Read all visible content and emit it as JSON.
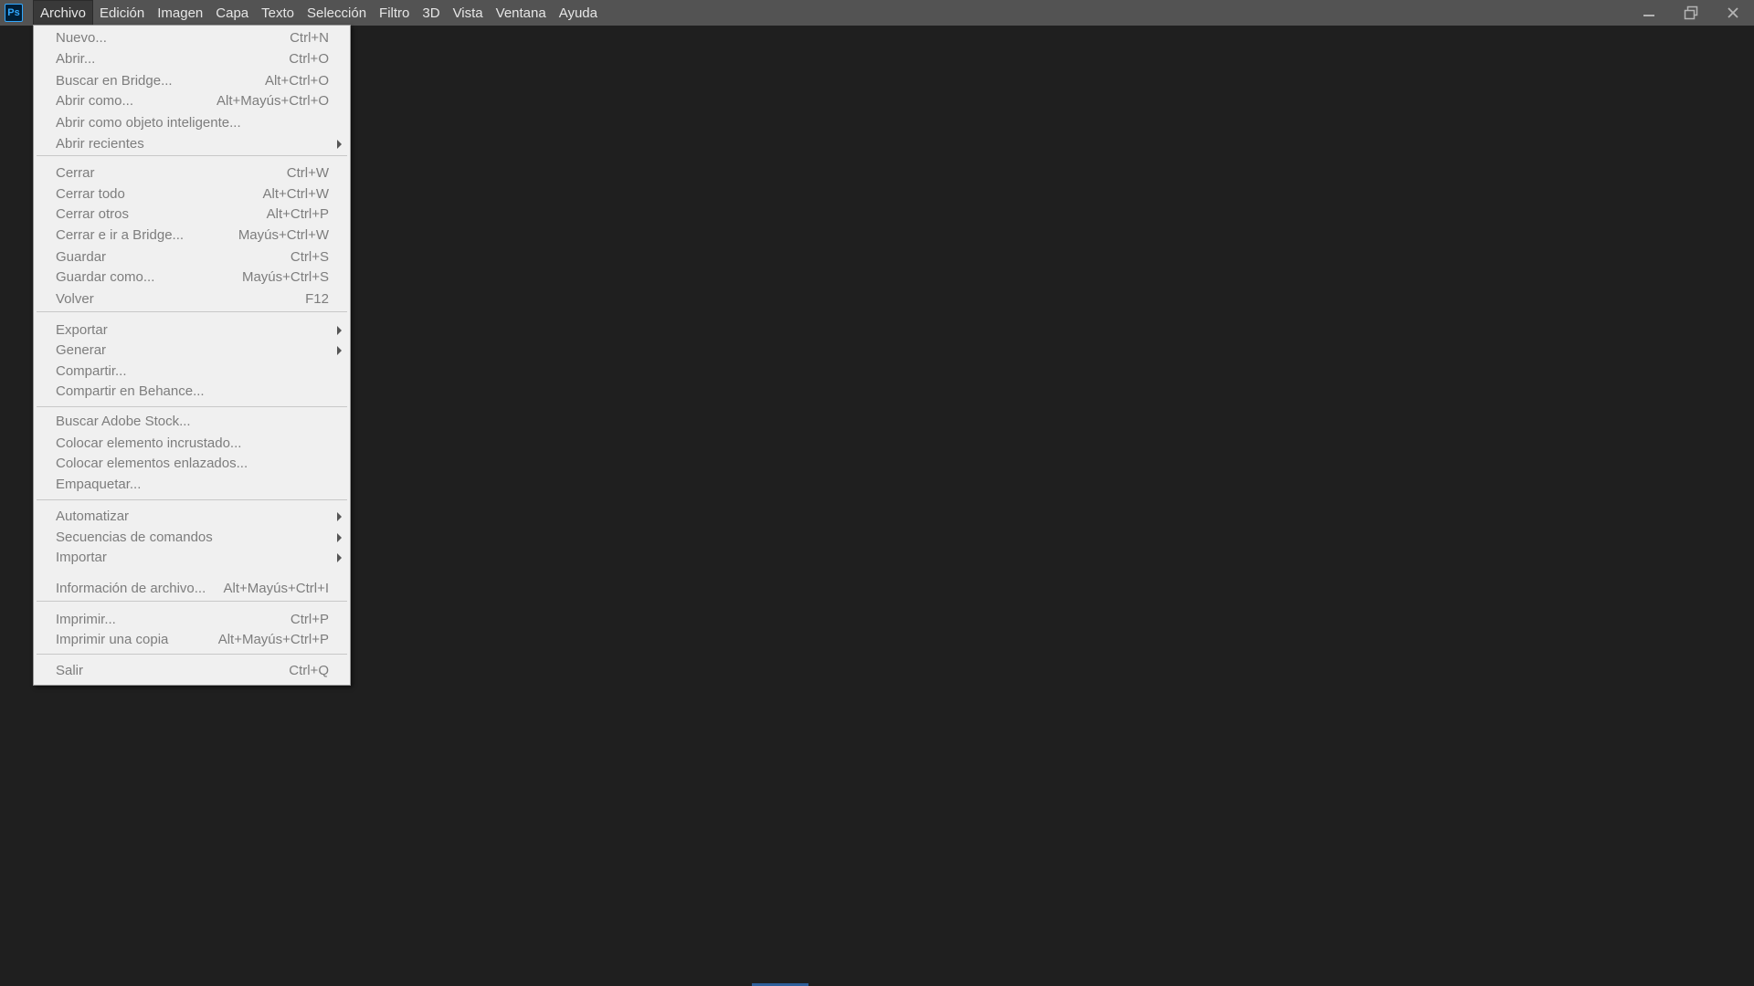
{
  "app": {
    "logo": "Ps"
  },
  "menubar": {
    "items": [
      "Archivo",
      "Edición",
      "Imagen",
      "Capa",
      "Texto",
      "Selección",
      "Filtro",
      "3D",
      "Vista",
      "Ventana",
      "Ayuda"
    ],
    "active": "Archivo"
  },
  "window_controls": {
    "icons": [
      "minimize-icon",
      "restore-icon",
      "close-icon"
    ]
  },
  "file_menu": {
    "items": [
      {
        "label": "Nuevo...",
        "shortcut": "Ctrl+N"
      },
      {
        "label": "Abrir...",
        "shortcut": "Ctrl+O"
      },
      {
        "label": "Buscar en Bridge...",
        "shortcut": "Alt+Ctrl+O"
      },
      {
        "label": "Abrir como...",
        "shortcut": "Alt+Mayús+Ctrl+O"
      },
      {
        "label": "Abrir como objeto inteligente...",
        "shortcut": ""
      },
      {
        "label": "Abrir recientes",
        "shortcut": "",
        "submenu": true
      },
      {
        "label": "Cerrar",
        "shortcut": "Ctrl+W"
      },
      {
        "label": "Cerrar todo",
        "shortcut": "Alt+Ctrl+W"
      },
      {
        "label": "Cerrar otros",
        "shortcut": "Alt+Ctrl+P"
      },
      {
        "label": "Cerrar e ir a Bridge...",
        "shortcut": "Mayús+Ctrl+W"
      },
      {
        "label": "Guardar",
        "shortcut": "Ctrl+S"
      },
      {
        "label": "Guardar como...",
        "shortcut": "Mayús+Ctrl+S"
      },
      {
        "label": "Volver",
        "shortcut": "F12"
      },
      {
        "label": "Exportar",
        "shortcut": "",
        "submenu": true
      },
      {
        "label": "Generar",
        "shortcut": "",
        "submenu": true
      },
      {
        "label": "Compartir...",
        "shortcut": ""
      },
      {
        "label": "Compartir en Behance...",
        "shortcut": ""
      },
      {
        "label": "Buscar Adobe Stock...",
        "shortcut": ""
      },
      {
        "label": "Colocar elemento incrustado...",
        "shortcut": ""
      },
      {
        "label": "Colocar elementos enlazados...",
        "shortcut": ""
      },
      {
        "label": "Empaquetar...",
        "shortcut": ""
      },
      {
        "label": "Automatizar",
        "shortcut": "",
        "submenu": true
      },
      {
        "label": "Secuencias de comandos",
        "shortcut": "",
        "submenu": true
      },
      {
        "label": "Importar",
        "shortcut": "",
        "submenu": true
      },
      {
        "label": "Información de archivo...",
        "shortcut": "Alt+Mayús+Ctrl+I"
      },
      {
        "label": "Imprimir...",
        "shortcut": "Ctrl+P"
      },
      {
        "label": "Imprimir una copia",
        "shortcut": "Alt+Mayús+Ctrl+P"
      },
      {
        "label": "Salir",
        "shortcut": "Ctrl+Q"
      }
    ]
  },
  "colors": {
    "menubar_bg": "#535353",
    "workspace_bg": "#1f1f1f",
    "menu_bg": "#f0f0f0",
    "menu_text_disabled": "#7d7d7d",
    "logo_blue": "#31a8ff"
  }
}
